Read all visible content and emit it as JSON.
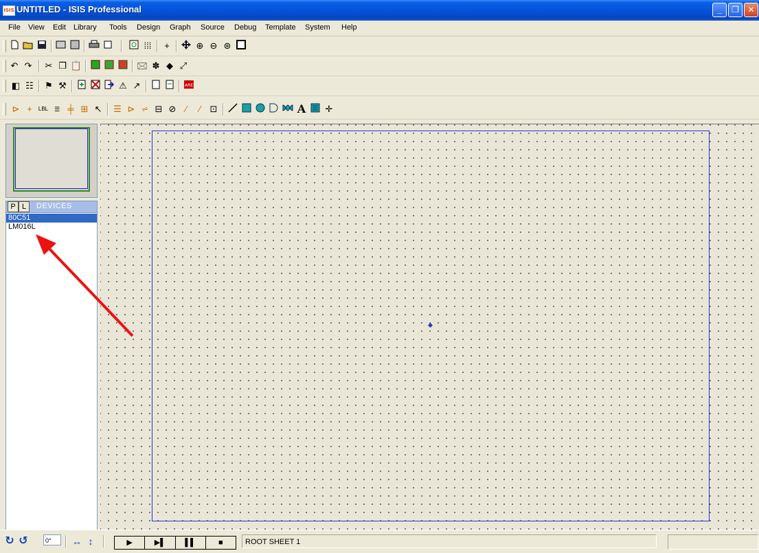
{
  "window": {
    "title": "UNTITLED - ISIS Professional",
    "icon_text": "ISIS",
    "min": "_",
    "max": "❐",
    "close": "✕"
  },
  "menu": [
    "File",
    "View",
    "Edit",
    "Library",
    "Tools",
    "Design",
    "Graph",
    "Source",
    "Debug",
    "Template",
    "System",
    "Help"
  ],
  "toolbar_icons": {
    "row1": [
      "new-file-icon",
      "open-folder-icon",
      "save-icon",
      "import-icon",
      "export-icon",
      "print-icon",
      "print-area-icon",
      "refresh-icon",
      "grid-icon",
      "origin-icon",
      "pan-icon",
      "zoom-in-icon",
      "zoom-out-icon",
      "zoom-all-icon",
      "zoom-area-icon"
    ],
    "row2": [
      "undo-icon",
      "redo-icon",
      "cut-icon",
      "copy-icon",
      "paste-icon",
      "block-copy-icon",
      "block-move-icon",
      "block-rotate-icon",
      "pick-device-icon",
      "make-device-icon",
      "packaging-icon",
      "decompose-icon"
    ],
    "row3": [
      "wire-autorouter-icon",
      "search-tag-icon",
      "property-assignment-icon",
      "new-sheet-icon",
      "remove-sheet-icon",
      "exit-to-parent-icon",
      "bom-icon",
      "erc-icon",
      "netlist-icon",
      "ares-icon"
    ],
    "row4": [
      "component-icon",
      "junction-icon",
      "wire-label-icon",
      "text-script-icon",
      "bus-icon",
      "subcircuit-icon",
      "selection-icon",
      "terminal-icon",
      "pin-icon",
      "graph-icon",
      "tape-recorder-icon",
      "generator-icon",
      "voltage-probe-icon",
      "current-probe-icon",
      "virtual-instrument-icon",
      "line-icon",
      "box-icon",
      "circle-icon",
      "arc-icon",
      "path-icon",
      "text-icon",
      "symbol-icon",
      "marker-icon"
    ]
  },
  "devices_panel": {
    "p_label": "P",
    "l_label": "L",
    "title": "DEVICES",
    "items": [
      "80C51",
      "LM016L"
    ],
    "selected": 0
  },
  "status": {
    "rotation": "0°",
    "sheet": "ROOT SHEET 1"
  },
  "transport": [
    "▶",
    "▶▌",
    "▌▌",
    "■"
  ],
  "colors": {
    "titlebar": "#0654d8",
    "sheet_border": "#2a35c8",
    "selection": "#316ac5",
    "arrow": "#ee1111"
  }
}
